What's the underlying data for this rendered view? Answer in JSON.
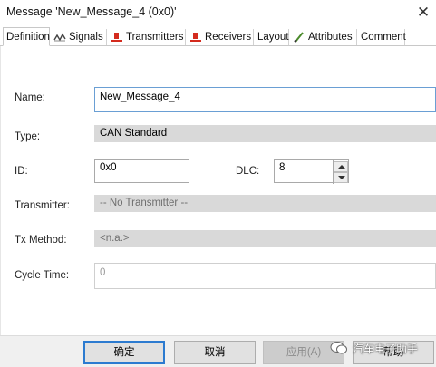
{
  "window": {
    "title": "Message 'New_Message_4 (0x0)'",
    "close_glyph": "✕"
  },
  "tabs": [
    {
      "label": "Definition",
      "icon": "none",
      "active": true
    },
    {
      "label": "Signals",
      "icon": "signals-icon"
    },
    {
      "label": "Transmitters",
      "icon": "transmitter-icon"
    },
    {
      "label": "Receivers",
      "icon": "receiver-icon"
    },
    {
      "label": "Layout",
      "icon": "none"
    },
    {
      "label": "Attributes",
      "icon": "attributes-icon"
    },
    {
      "label": "Comment",
      "icon": "none"
    }
  ],
  "form": {
    "name_label": "Name:",
    "name_value": "New_Message_4",
    "type_label": "Type:",
    "type_value": "CAN Standard",
    "id_label": "ID:",
    "id_value": "0x0",
    "dlc_label": "DLC:",
    "dlc_value": "8",
    "transmitter_label": "Transmitter:",
    "transmitter_value": "-- No Transmitter --",
    "txmethod_label": "Tx Method:",
    "txmethod_value": "<n.a.>",
    "cycletime_label": "Cycle Time:",
    "cycletime_value": "0"
  },
  "buttons": {
    "ok": "确定",
    "cancel": "取消",
    "apply": "应用(A)",
    "help": "帮助"
  },
  "watermark": {
    "text": "汽车电子助手"
  },
  "colors": {
    "accent": "#2c7bd0",
    "field_gray": "#d9d9d9",
    "icon_red": "#d42b1e"
  }
}
